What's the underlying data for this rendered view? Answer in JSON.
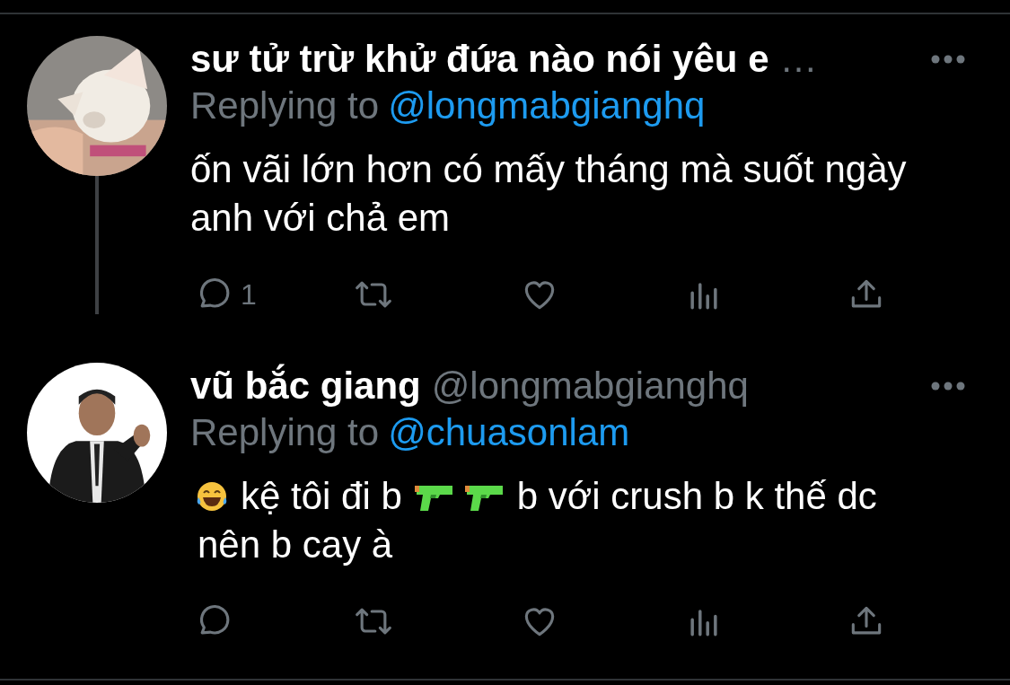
{
  "tweets": [
    {
      "avatar": {
        "kind": "picture"
      },
      "name": "sư tử trừ khử đứa nào nói yêu e",
      "truncation_mark": "…",
      "replying_label": "Replying to",
      "replying_to": "@longmabgianghq",
      "thread_line": true,
      "body": [
        {
          "kind": "text",
          "text": "ốn vãi lớn hơn có mấy tháng mà suốt ngày anh với chả em"
        }
      ],
      "actions": [
        {
          "kind": "reply",
          "count": "1"
        },
        {
          "kind": "retweet"
        },
        {
          "kind": "like"
        },
        {
          "kind": "analytics"
        },
        {
          "kind": "share"
        }
      ]
    },
    {
      "avatar": {
        "kind": "picture"
      },
      "name": "vũ bắc giang",
      "handle": "@longmabgianghq",
      "replying_label": "Replying to",
      "replying_to": "@chuasonlam",
      "thread_line": false,
      "body": [
        {
          "kind": "laugh"
        },
        {
          "kind": "text",
          "text": "kệ tôi đi b"
        },
        {
          "kind": "pistol"
        },
        {
          "kind": "pistol"
        },
        {
          "kind": "text",
          "text": "b với crush b k thế dc"
        },
        {
          "kind": "text",
          "text": "nên b cay à"
        }
      ],
      "actions": [
        {
          "kind": "reply"
        },
        {
          "kind": "retweet"
        },
        {
          "kind": "like"
        },
        {
          "kind": "analytics"
        },
        {
          "kind": "share"
        }
      ]
    }
  ]
}
